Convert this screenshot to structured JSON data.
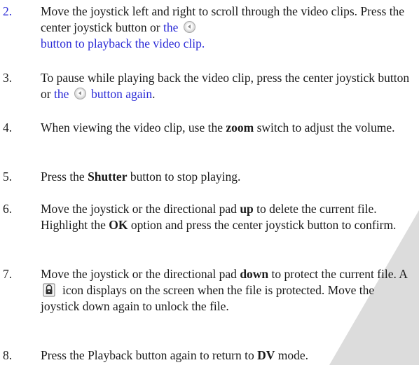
{
  "steps": [
    {
      "num": "2.",
      "p1": "Move the joystick left and right to scroll through the video clips. Press the center joystick button or ",
      "p2": "the",
      "p3": "button to playback the video clip."
    },
    {
      "num": "3.",
      "p1": "To pause while playing back the video clip, press the center joystick button or ",
      "p2": "the",
      "p3": "button again",
      "p4": "."
    },
    {
      "num": "4.",
      "p1": "When viewing the video clip, use the ",
      "b1": "zoom",
      "p2": " switch to adjust the volume."
    },
    {
      "num": "5.",
      "p1": "Press the ",
      "b1": "Shutter",
      "p2": " button to stop playing."
    },
    {
      "num": "6.",
      "p1": "Move the joystick or the directional pad ",
      "b1": "up",
      "p2": " to delete the current file. Highlight the ",
      "b2": "OK",
      "p3": " option and press the center joystick button to confirm."
    },
    {
      "num": "7.",
      "p1": "Move the joystick or the directional pad ",
      "b1": "down",
      "p2": " to protect the current file. A",
      "p3": "icon displays on the screen when the file is protected. Move the joystick down again to unlock the file."
    },
    {
      "num": "8.",
      "p1": "Press the Playback button again to return to ",
      "b1": "DV",
      "p2": " mode."
    }
  ],
  "icons": {
    "playback": "playback-button-icon",
    "protect": "lock-icon"
  },
  "colors": {
    "link": "#2b2bd6",
    "text": "#1a1a1a",
    "corner": "#dcdcdc"
  }
}
